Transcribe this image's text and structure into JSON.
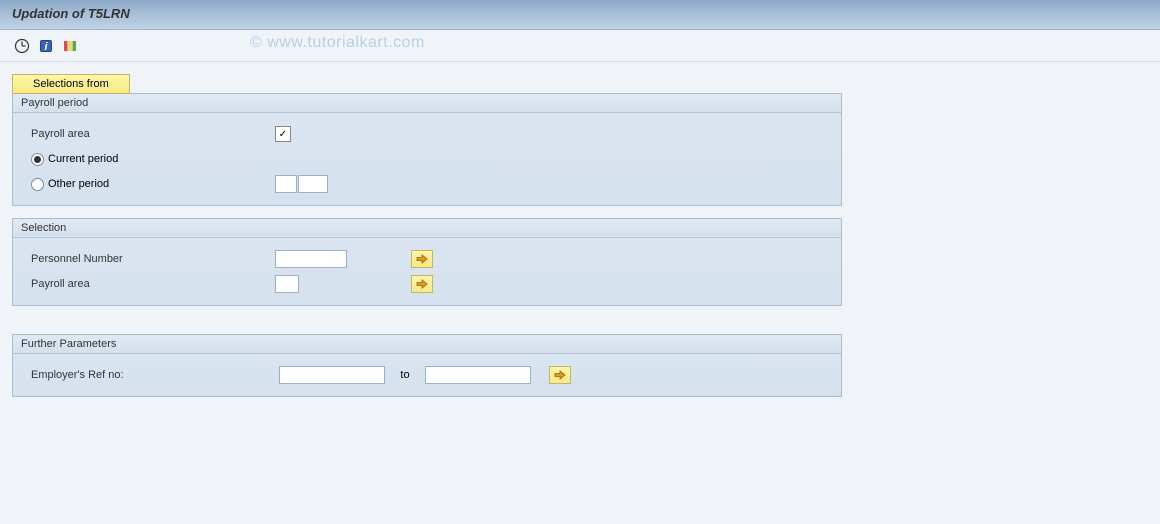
{
  "title": "Updation of T5LRN",
  "watermark": "© www.tutorialkart.com",
  "buttons": {
    "selections_from": "Selections from"
  },
  "groups": {
    "payroll_period": {
      "header": "Payroll period",
      "payroll_area_label": "Payroll area",
      "payroll_area_checked": "☑",
      "current_period_label": "Current period",
      "other_period_label": "Other period"
    },
    "selection": {
      "header": "Selection",
      "personnel_number_label": "Personnel Number",
      "payroll_area_label": "Payroll area"
    },
    "further_parameters": {
      "header": "Further Parameters",
      "employer_ref_label": "Employer's Ref no:",
      "to_label": "to"
    }
  }
}
